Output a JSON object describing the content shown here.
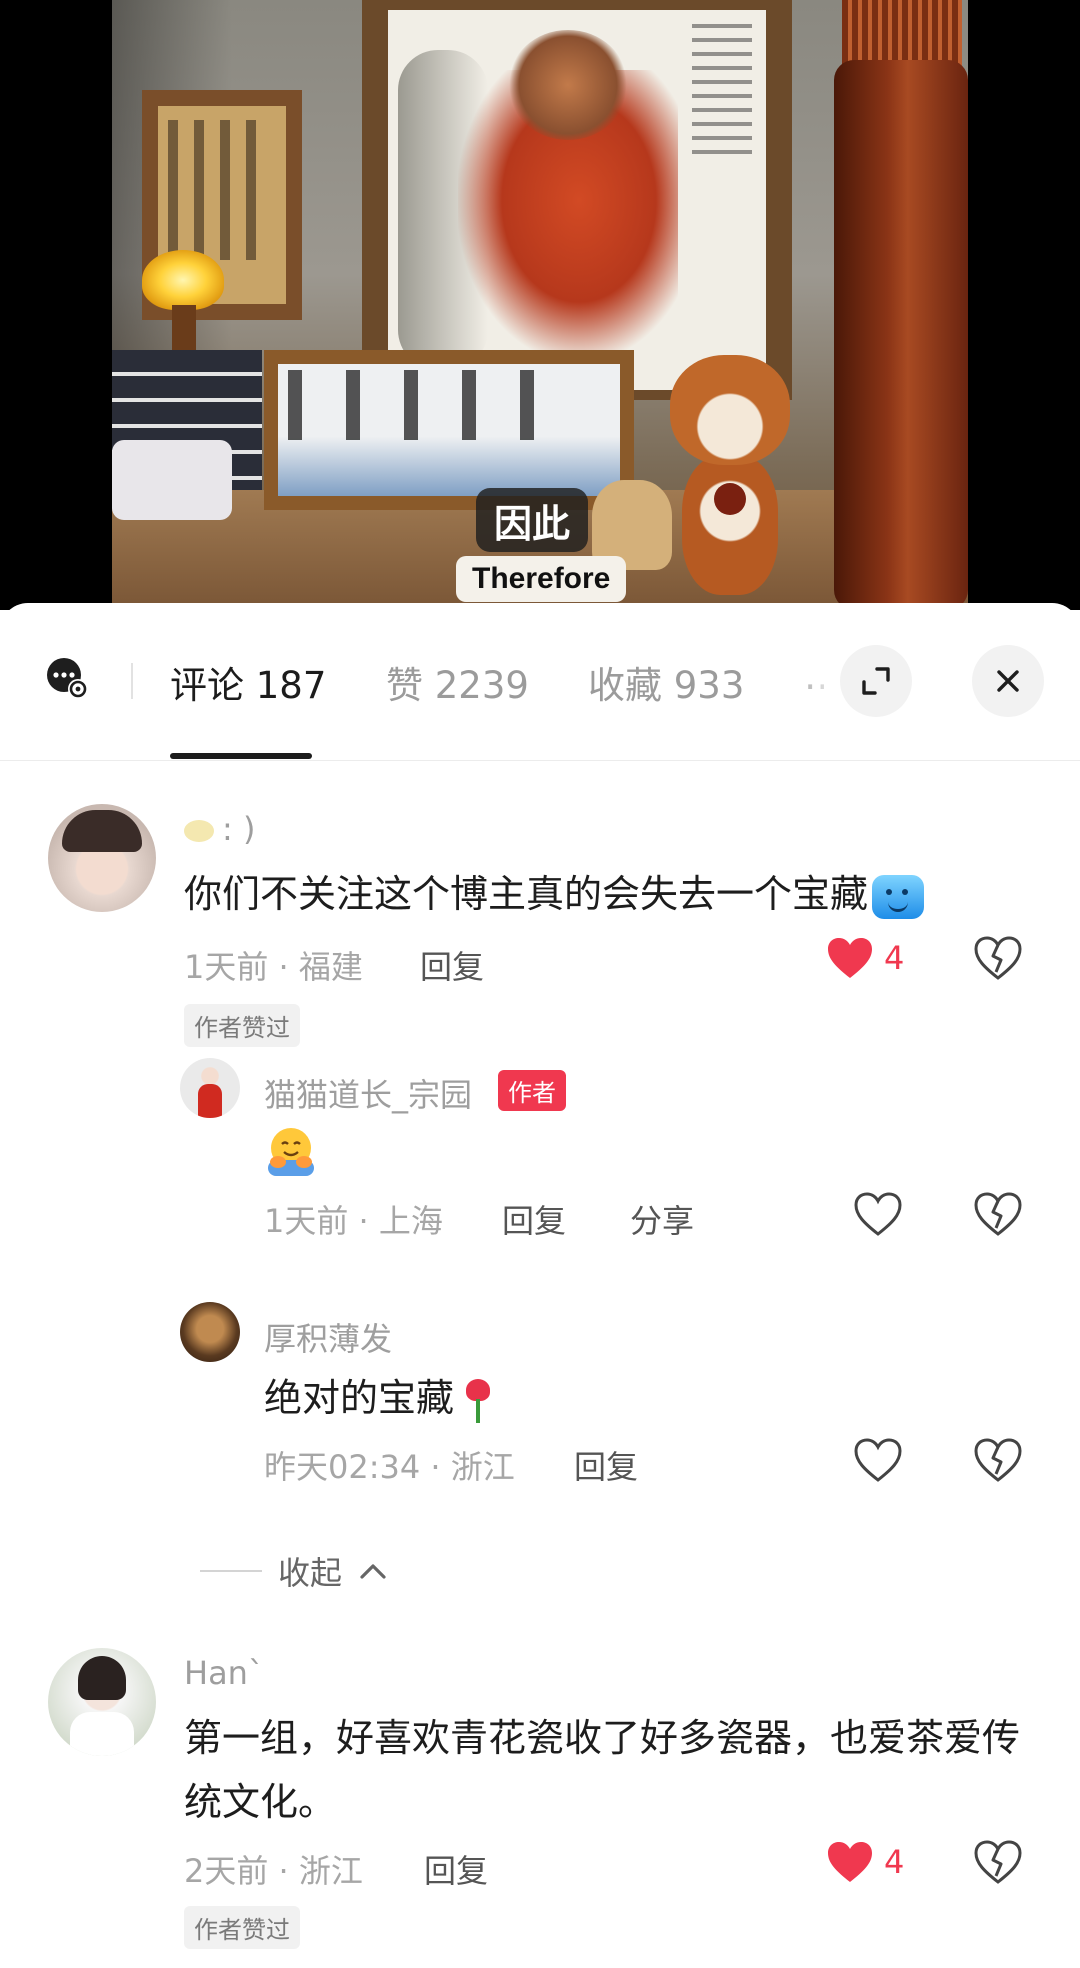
{
  "video": {
    "subtitle_zh": "因此",
    "subtitle_en": "Therefore"
  },
  "tabs": {
    "comments_label": "评论",
    "comments_count": "187",
    "likes_label": "赞",
    "likes_count": "2239",
    "favorites_label": "收藏",
    "favorites_count": "933",
    "overflow_label": "…"
  },
  "comments": [
    {
      "user": ": )",
      "text": "你们不关注这个博主真的会失去一个宝藏",
      "time": "1天前",
      "location": "福建",
      "reply_label": "回复",
      "likes": "4",
      "author_liked": "作者赞过"
    },
    {
      "user": "猫猫道长_宗园",
      "author_badge": "作者",
      "time": "1天前",
      "location": "上海",
      "reply_label": "回复",
      "share_label": "分享"
    },
    {
      "user": "厚积薄发",
      "text": "绝对的宝藏",
      "time": "昨天02:34",
      "location": "浙江",
      "reply_label": "回复"
    },
    {
      "user": "Han`",
      "text": "第一组，好喜欢青花瓷收了好多瓷器，也爱茶爱传统文化。",
      "time": "2天前",
      "location": "浙江",
      "reply_label": "回复",
      "likes": "4",
      "author_liked": "作者赞过"
    }
  ],
  "collapse_label": "收起",
  "colors": {
    "accent_red": "#f0384f",
    "text_primary": "#1d1d1d",
    "text_muted": "#a6a6a6"
  },
  "icons": [
    "chat-settings-icon",
    "expand-icon",
    "close-icon",
    "heart-filled-icon",
    "heart-outline-icon",
    "dislike-icon",
    "chevron-up-icon"
  ]
}
